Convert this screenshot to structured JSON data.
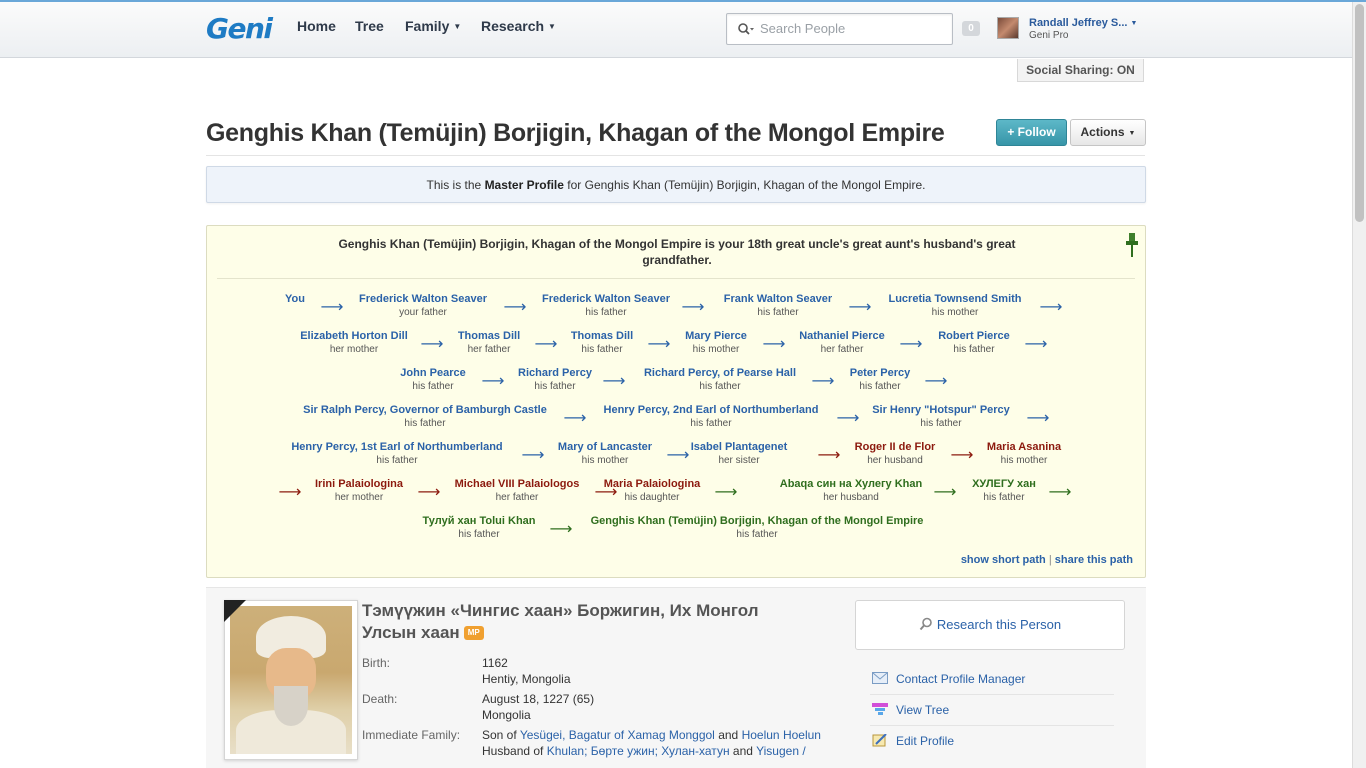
{
  "nav": {
    "logo": "Geni",
    "items": [
      {
        "label": "Home"
      },
      {
        "label": "Tree"
      },
      {
        "label": "Family"
      },
      {
        "label": "Research"
      }
    ],
    "search_placeholder": "Search People",
    "notification_count": "0",
    "user_name": "Randall Jeffrey S...",
    "user_plan": "Geni Pro",
    "social_sharing": "Social Sharing: ON"
  },
  "profile": {
    "title": "Genghis Khan (Temüjin) Borjigin, Khagan of the Mongol Empire",
    "follow_label": "+ Follow",
    "actions_label": "Actions",
    "master_prefix": "This is the",
    "master_bold": "Master Profile",
    "master_suffix": "for Genghis Khan (Temüjin) Borjigin, Khagan of the Mongol Empire."
  },
  "relationship": {
    "headline": "Genghis Khan (Temüjin) Borjigin, Khagan of the Mongol Empire is your 18th great uncle's great aunt's husband's great grandfather.",
    "show_short_path": "show short path",
    "separator": "|",
    "share_path": "share this path",
    "colors": {
      "blue": "#2b62a8",
      "red": "#8c1a0e",
      "green": "#2f6e1e"
    },
    "rows": [
      [
        {
          "name": "You",
          "role": "",
          "color": "blue"
        },
        {
          "name": "Frederick Walton Seaver",
          "role": "your father",
          "color": "blue"
        },
        {
          "name": "Frederick Walton Seaver",
          "role": "his father",
          "color": "blue"
        },
        {
          "name": "Frank Walton Seaver",
          "role": "his father",
          "color": "blue"
        },
        {
          "name": "Lucretia Townsend Smith",
          "role": "his mother",
          "color": "blue"
        }
      ],
      [
        {
          "name": "Elizabeth Horton Dill",
          "role": "her mother",
          "color": "blue"
        },
        {
          "name": "Thomas Dill",
          "role": "her father",
          "color": "blue"
        },
        {
          "name": "Thomas Dill",
          "role": "his father",
          "color": "blue"
        },
        {
          "name": "Mary Pierce",
          "role": "his mother",
          "color": "blue"
        },
        {
          "name": "Nathaniel Pierce",
          "role": "her father",
          "color": "blue"
        },
        {
          "name": "Robert Pierce",
          "role": "his father",
          "color": "blue"
        }
      ],
      [
        {
          "name": "John Pearce",
          "role": "his father",
          "color": "blue"
        },
        {
          "name": "Richard Percy",
          "role": "his father",
          "color": "blue"
        },
        {
          "name": "Richard Percy, of Pearse Hall",
          "role": "his father",
          "color": "blue"
        },
        {
          "name": "Peter Percy",
          "role": "his father",
          "color": "blue"
        }
      ],
      [
        {
          "name": "Sir Ralph Percy, Governor of Bamburgh Castle",
          "role": "his father",
          "color": "blue"
        },
        {
          "name": "Henry Percy, 2nd Earl of Northumberland",
          "role": "his father",
          "color": "blue"
        },
        {
          "name": "Sir Henry \"Hotspur\" Percy",
          "role": "his father",
          "color": "blue"
        }
      ],
      [
        {
          "name": "Henry Percy, 1st Earl of Northumberland",
          "role": "his father",
          "color": "blue"
        },
        {
          "name": "Mary of Lancaster",
          "role": "his mother",
          "color": "blue"
        },
        {
          "name": "Isabel Plantagenet",
          "role": "her sister",
          "color": "blue"
        },
        {
          "name": "Roger II de Flor",
          "role": "her husband",
          "color": "red"
        },
        {
          "name": "Maria Asanina",
          "role": "his mother",
          "color": "red"
        }
      ],
      [
        {
          "name": "Irini Palaiologina",
          "role": "her mother",
          "color": "red"
        },
        {
          "name": "Michael VIII Palaiologos",
          "role": "her father",
          "color": "red"
        },
        {
          "name": "Maria Palaiologina",
          "role": "his daughter",
          "color": "red"
        },
        {
          "name": "Abaqa син на Хулегу Khan",
          "role": "her husband",
          "color": "green"
        },
        {
          "name": "ХУЛЕГУ хан",
          "role": "his father",
          "color": "green"
        }
      ],
      [
        {
          "name": "Тулуй хан Tolui Khan",
          "role": "his father",
          "color": "green"
        },
        {
          "name": "Genghis Khan (Temüjin) Borjigin, Khagan of the Mongol Empire",
          "role": "his father",
          "color": "green"
        }
      ]
    ]
  },
  "person": {
    "native_name": "Тэмүүжин «Чингис хаан» Боржигин, Их Монгол Улсын хаан",
    "mp_badge": "MP",
    "birth_label": "Birth:",
    "birth_date": "1162",
    "birth_place": "Hentiy, Mongolia",
    "death_label": "Death:",
    "death_date": "August 18, 1227 (65)",
    "death_place": "Mongolia",
    "family_label": "Immediate Family:",
    "son_of": "Son of",
    "father": "Yesügei, Bagatur of Xamag Monggol",
    "and": "and",
    "mother": "Hoelun Hoelun",
    "husband_of": "Husband of",
    "spouse1": "Khulan; Бөрте ужин; Хулан-хатун",
    "spouse2": "Yisugen /"
  },
  "sidebar": {
    "research": "Research this Person",
    "links": [
      {
        "label": "Contact Profile Manager",
        "icon": "envelope-icon"
      },
      {
        "label": "View Tree",
        "icon": "tree-icon"
      },
      {
        "label": "Edit Profile",
        "icon": "edit-icon"
      }
    ]
  }
}
